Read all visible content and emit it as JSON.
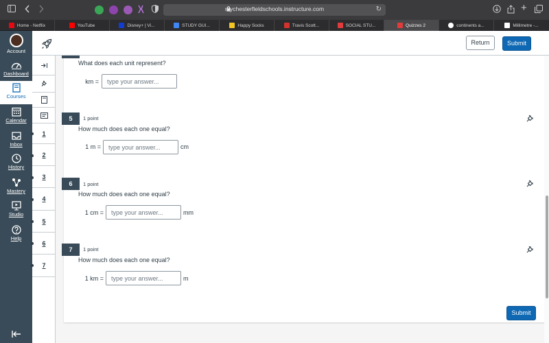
{
  "browser": {
    "url": "mychesterfieldschools.instructure.com",
    "tabs": [
      {
        "label": "Home - Netflix",
        "color": "#e50914"
      },
      {
        "label": "YouTube",
        "color": "#ff0000"
      },
      {
        "label": "Disney+ | Vi...",
        "color": "#113ccf"
      },
      {
        "label": "STUDY GUI...",
        "color": "#4285f4"
      },
      {
        "label": "Happy Socks",
        "color": "#f3c623"
      },
      {
        "label": "Travis Scott...",
        "color": "#d0342c"
      },
      {
        "label": "SOCIAL STU...",
        "color": "#e13c3c"
      },
      {
        "label": "Quizzes 2",
        "color": "#e13c3c"
      },
      {
        "label": "continents a...",
        "color": "#ffffff"
      },
      {
        "label": "Millimetre -...",
        "color": "#ffffff"
      }
    ]
  },
  "global_nav": {
    "items": [
      {
        "label": "Account",
        "icon": "avatar"
      },
      {
        "label": "Dashboard",
        "icon": "dashboard-icon"
      },
      {
        "label": "Courses",
        "icon": "courses-icon"
      },
      {
        "label": "Calendar",
        "icon": "calendar-icon"
      },
      {
        "label": "Inbox",
        "icon": "inbox-icon"
      },
      {
        "label": "History",
        "icon": "history-icon"
      },
      {
        "label": "Mastery",
        "icon": "mastery-icon"
      },
      {
        "label": "Studio",
        "icon": "studio-icon"
      },
      {
        "label": "Help",
        "icon": "help-icon"
      }
    ]
  },
  "header": {
    "return_label": "Return",
    "submit_label": "Submit"
  },
  "question_nav": {
    "numbers": [
      "1",
      "2",
      "3",
      "4",
      "5",
      "6",
      "7"
    ]
  },
  "questions": {
    "q4": {
      "prompt": "What does each unit represent?",
      "field_label": "km =",
      "placeholder": "type your answer...",
      "value": ""
    },
    "q5": {
      "number": "5",
      "points": "1 point",
      "prompt": "How much does each one equal?",
      "field_label": "1 m =",
      "placeholder": "type your answer...",
      "unit": "cm",
      "value": ""
    },
    "q6": {
      "number": "6",
      "points": "1 point",
      "prompt": "How much does each one equal?",
      "field_label": "1 cm =",
      "placeholder": "type your answer...",
      "unit": "mm",
      "value": ""
    },
    "q7": {
      "number": "7",
      "points": "1 point",
      "prompt": "How much does each one equal?",
      "field_label": "1 km =",
      "placeholder": "type your answer...",
      "unit": "m",
      "value": ""
    }
  },
  "footer": {
    "submit_label": "Submit"
  },
  "colors": {
    "nav_bg": "#394b58",
    "primary": "#0e68b3"
  }
}
